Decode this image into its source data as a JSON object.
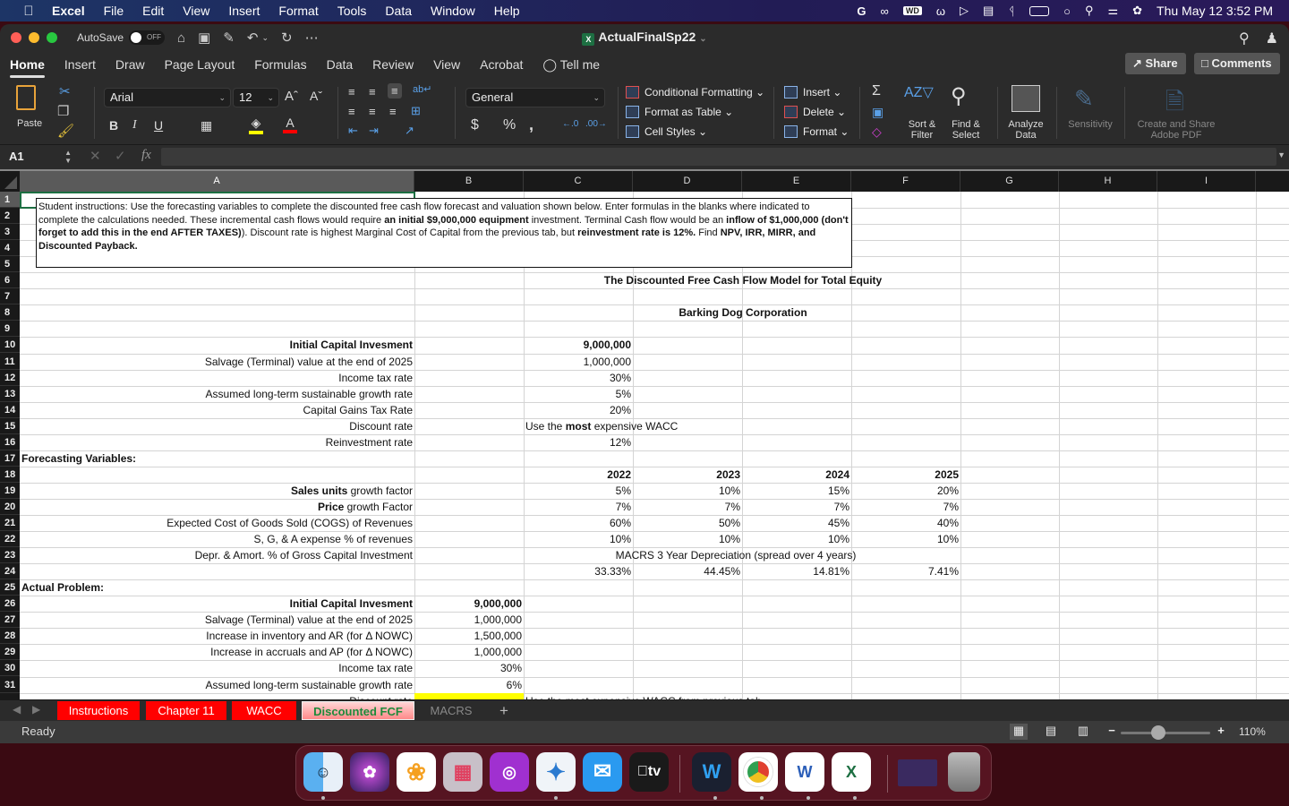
{
  "menubar": {
    "app": "Excel",
    "items": [
      "File",
      "Edit",
      "View",
      "Insert",
      "Format",
      "Tools",
      "Data",
      "Window",
      "Help"
    ],
    "datetime": "Thu May 12  3:52 PM"
  },
  "window": {
    "autosave_label": "AutoSave",
    "autosave_state": "OFF",
    "title": "ActualFinalSp22"
  },
  "ribbon_tabs": [
    "Home",
    "Insert",
    "Draw",
    "Page Layout",
    "Formulas",
    "Data",
    "Review",
    "View",
    "Acrobat",
    "Tell me"
  ],
  "share_label": "Share",
  "comments_label": "Comments",
  "ribbon": {
    "paste": "Paste",
    "font_name": "Arial",
    "font_size": "12",
    "number_format": "General",
    "conditional_formatting": "Conditional Formatting",
    "format_as_table": "Format as Table",
    "cell_styles": "Cell Styles",
    "insert": "Insert",
    "delete": "Delete",
    "format": "Format",
    "sort_filter": "Sort &\nFilter",
    "find_select": "Find &\nSelect",
    "analyze_data": "Analyze\nData",
    "sensitivity": "Sensitivity",
    "adobe_pdf": "Create and Share\nAdobe PDF"
  },
  "formula_bar": {
    "name_box": "A1",
    "formula": ""
  },
  "columns": [
    "A",
    "B",
    "C",
    "D",
    "E",
    "F",
    "G",
    "H",
    "I"
  ],
  "rows": [
    1,
    2,
    3,
    4,
    5,
    6,
    7,
    8,
    9,
    10,
    11,
    12,
    13,
    14,
    15,
    16,
    17,
    18,
    19,
    20,
    21,
    22,
    23,
    24,
    25,
    26,
    27,
    28,
    29,
    30,
    31
  ],
  "instructions": {
    "t1": "Student instructions:  Use the forecasting variables to complete the discounted free cash flow forecast and valuation shown below.  Enter formulas in the blanks where indicated to complete the calculations needed.  These incremental cash flows would require ",
    "b1": "an initial $9,000,000 equipment",
    "t2": " investment.  Terminal Cash flow would be an ",
    "b2": "inflow of $1,000,000 (don't forget to add this in the end AFTER TAXES)",
    "t3": ").  Discount rate is highest Marginal Cost of Capital from the previous tab, but ",
    "b3": "reinvestment rate is 12%.",
    "t4": "  Find ",
    "b4": "NPV, IRR, MIRR, and Discounted Payback."
  },
  "headings": {
    "model_title": "The Discounted Free Cash Flow Model for Total  Equity",
    "company": "Barking Dog Corporation"
  },
  "inputs": [
    {
      "label": "Initial Capital Invesment",
      "value": "9,000,000",
      "bold": true
    },
    {
      "label": "Salvage (Terminal) value at the end of 2025",
      "value": "1,000,000"
    },
    {
      "label": "Income tax rate",
      "value": "30%"
    },
    {
      "label": "Assumed long-term sustainable growth rate",
      "value": "5%"
    },
    {
      "label": "Capital Gains Tax Rate",
      "value": "20%"
    },
    {
      "label": "Discount rate",
      "value_pre": "Use the ",
      "value_bold": "most",
      "value_post": " expensive WACC"
    },
    {
      "label": "Reinvestment rate",
      "value": "12%"
    }
  ],
  "forecasting": {
    "title": "Forecasting Variables:",
    "years": [
      "2022",
      "2023",
      "2024",
      "2025"
    ],
    "rows": [
      {
        "label_bold": "Sales units",
        "label": " growth factor",
        "values": [
          "5%",
          "10%",
          "15%",
          "20%"
        ]
      },
      {
        "label_bold": "Price",
        "label": " growth Factor",
        "values": [
          "7%",
          "7%",
          "7%",
          "7%"
        ]
      },
      {
        "label_bold": "",
        "label": "Expected Cost of Goods Sold (COGS) of Revenues",
        "values": [
          "60%",
          "50%",
          "45%",
          "40%"
        ]
      },
      {
        "label_bold": "",
        "label": "S, G, & A expense % of revenues",
        "values": [
          "10%",
          "10%",
          "10%",
          "10%"
        ]
      }
    ],
    "depr_label": "Depr. & Amort. % of Gross Capital Investment",
    "macrs_note": "MACRS 3 Year Depreciation (spread over 4 years)",
    "macrs": [
      "33.33%",
      "44.45%",
      "14.81%",
      "7.41%"
    ]
  },
  "actual": {
    "title": "Actual Problem:",
    "rows": [
      {
        "label": "Initial Capital Invesment",
        "value": "9,000,000",
        "bold": true
      },
      {
        "label": "Salvage (Terminal) value at the end of 2025",
        "value": "1,000,000"
      },
      {
        "label": "Increase in inventory and AR (for Δ NOWC)",
        "value": "1,500,000"
      },
      {
        "label": "Increase in accruals and AP (for Δ NOWC)",
        "value": "1,000,000"
      },
      {
        "label": "Income tax rate",
        "value": "30%"
      },
      {
        "label": "Assumed long-term sustainable growth rate",
        "value": "6%"
      }
    ],
    "partial_label": "Discount rate",
    "partial_note": "Use the most expensive WACC from previous tab"
  },
  "sheet_tabs": [
    {
      "label": "Instructions",
      "style": "red"
    },
    {
      "label": "Chapter 11",
      "style": "red"
    },
    {
      "label": "WACC",
      "style": "red"
    },
    {
      "label": "Discounted FCF",
      "style": "active"
    },
    {
      "label": "MACRS",
      "style": "plain"
    }
  ],
  "status": {
    "ready": "Ready",
    "zoom": "110%",
    "zoom_fraction": 0.42
  },
  "dock": [
    "Finder",
    "Siri",
    "Photos",
    "Launchpad",
    "Podcasts",
    "Safari",
    "Mail",
    "Apple TV",
    "Webex",
    "Chrome",
    "Word",
    "Excel",
    "Safari Window",
    "Trash"
  ],
  "colors": {
    "excel_green": "#1d6f42",
    "tab_red": "#ff0000",
    "highlight_yellow": "#ffff00"
  }
}
